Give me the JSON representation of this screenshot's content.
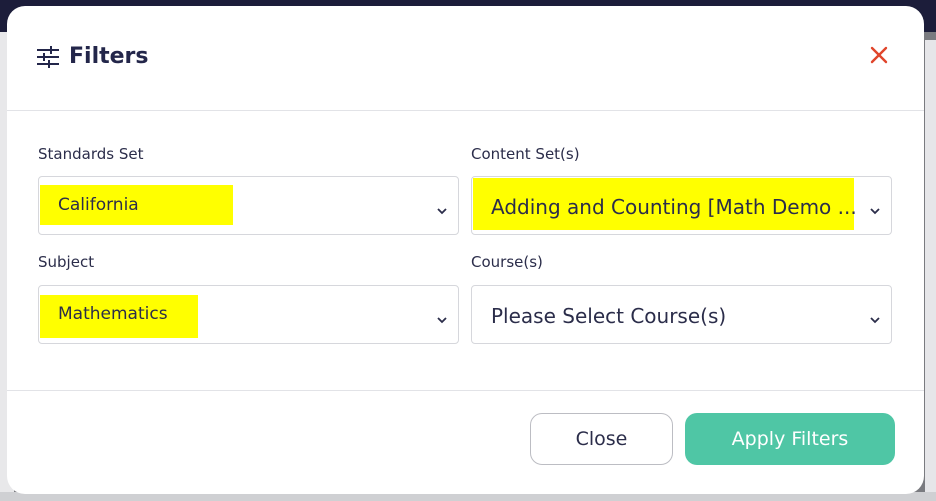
{
  "colors": {
    "accent": "#4fc6a5",
    "title": "#23264a",
    "close": "#e0452b",
    "highlight": "#ffff00"
  },
  "modal": {
    "title": "Filters",
    "title_icon": "sliders-icon",
    "close_icon": "close-icon"
  },
  "fields": {
    "standards_set": {
      "label": "Standards Set",
      "value": "California"
    },
    "content_sets": {
      "label": "Content Set(s)",
      "value": "Adding and Counting [Math Demo ..."
    },
    "subject": {
      "label": "Subject",
      "value": "Mathematics"
    },
    "courses": {
      "label": "Course(s)",
      "value": "Please Select Course(s)"
    }
  },
  "footer": {
    "close_label": "Close",
    "apply_label": "Apply Filters"
  }
}
